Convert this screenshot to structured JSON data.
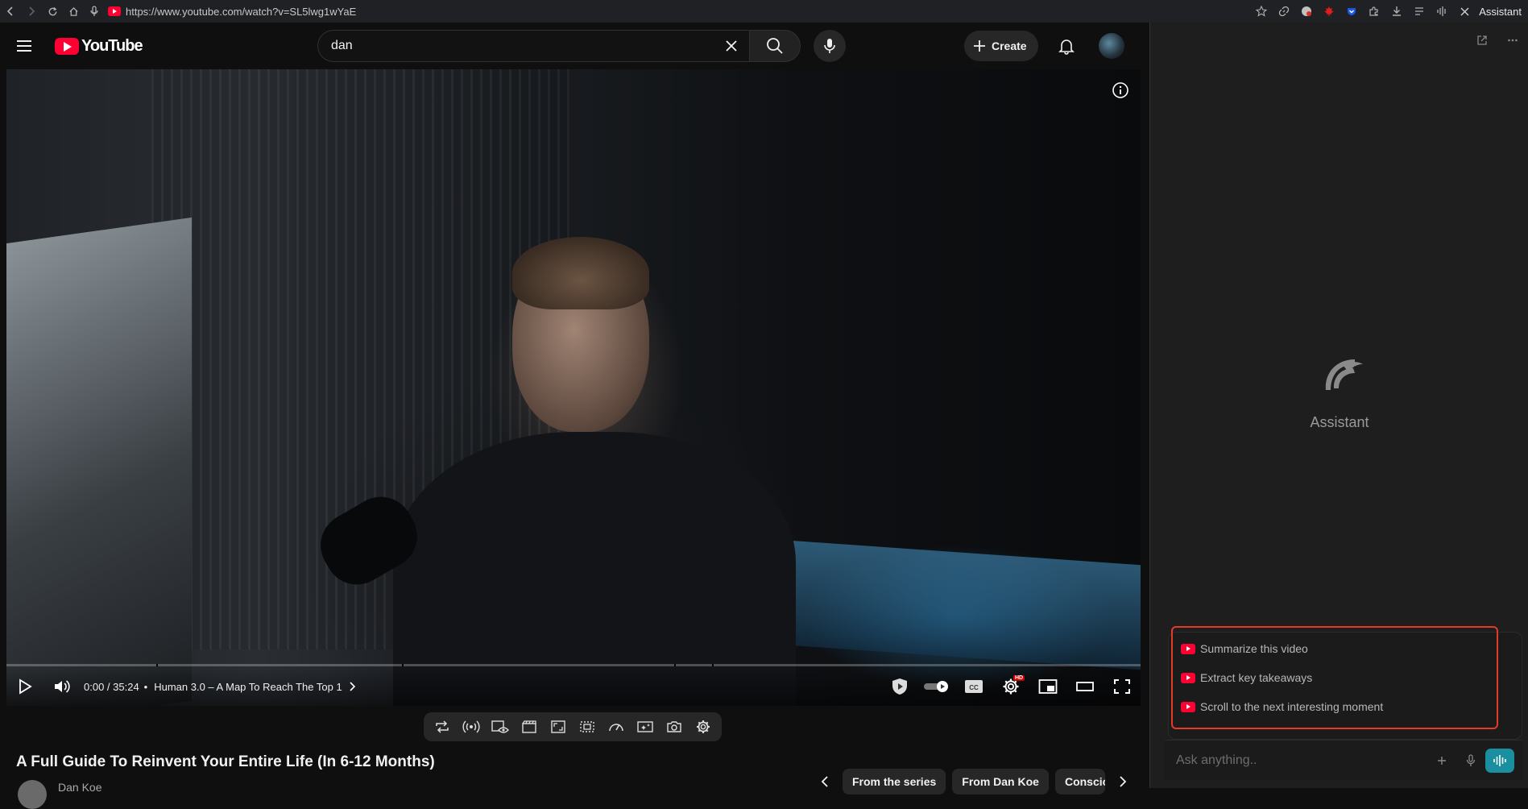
{
  "browser": {
    "url": "https://www.youtube.com/watch?v=SL5lwg1wYaE",
    "assistant_label": "Assistant"
  },
  "header": {
    "logo_text": "YouTube",
    "search_value": "dan",
    "create_label": "Create"
  },
  "player": {
    "time": "0:00 / 35:24",
    "separator": "•",
    "chapter": "Human 3.0 – A Map To Reach The Top 1",
    "hd_badge": "HD",
    "progress_percent": 0
  },
  "video": {
    "title": "A Full Guide To Reinvent Your Entire Life (In 6-12 Months)",
    "channel_partial": "Dan Koe"
  },
  "chips": [
    "From the series",
    "From Dan Koe",
    "Conscious"
  ],
  "assistant": {
    "title": "Assistant",
    "suggestions": [
      "Summarize this video",
      "Extract key takeaways",
      "Scroll to the next interesting moment"
    ],
    "placeholder": "Ask anything.."
  },
  "colors": {
    "accent_red": "#ff0033",
    "highlight_border": "#e23b2b",
    "voice_button": "#1a8fa0"
  }
}
